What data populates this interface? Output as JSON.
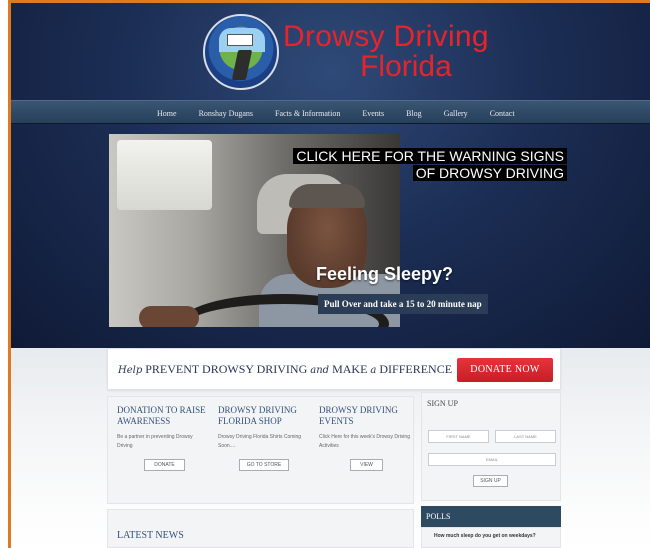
{
  "brand": {
    "line1": "Drowsy Driving",
    "line2": "Florida",
    "seal_icon": "drowsy-driving-florida-seal",
    "color": "#e8232b"
  },
  "nav": {
    "items": [
      "Home",
      "Ronshay Dugans",
      "Facts & Information",
      "Events",
      "Blog",
      "Gallery",
      "Contact"
    ]
  },
  "banner": {
    "warning_line1": "CLICK HERE FOR THE WARNING SIGNS",
    "warning_line2": "OF DROWSY DRIVING",
    "headline": "Feeling Sleepy?",
    "subtext": "Pull Over and take a 15 to 20 minute nap"
  },
  "donate": {
    "tag_help": "Help",
    "tag_prevent": "PREVENT DROWSY DRIVING",
    "tag_and": "and",
    "tag_make": "MAKE",
    "tag_a": "a",
    "tag_difference": "DIFFERENCE",
    "button": "DONATE NOW",
    "button_color": "#d6262e"
  },
  "columns": [
    {
      "title": "DONATION TO RAISE AWARENESS",
      "text": "Be a partner in preventing Drowsy Driving",
      "button": "DONATE"
    },
    {
      "title": "DROWSY DRIVING FLORIDA SHOP",
      "text": "Drowsy Driving Florida Shirts Coming Soon....",
      "button": "GO TO STORE"
    },
    {
      "title": "DROWSY DRIVING EVENTS",
      "text": "Click Here for this week's Drowsy Driving Activities",
      "button": "VIEW"
    }
  ],
  "news": {
    "title": "LATEST NEWS"
  },
  "signup": {
    "title": "SIGN UP",
    "first_name": "FIRST NAME",
    "last_name": "LAST NAME",
    "email": "EMAIL",
    "button": "SIGN UP"
  },
  "polls": {
    "title": "POLLS",
    "question": "How much sleep do you get on weekdays?"
  }
}
